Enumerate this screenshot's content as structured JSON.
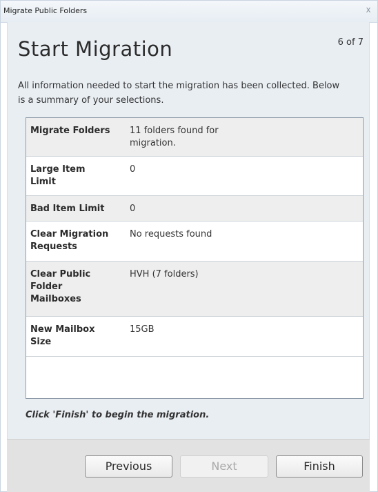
{
  "window": {
    "title": "Migrate Public Folders",
    "close_glyph": "x"
  },
  "header": {
    "title": "Start Migration",
    "step": "6 of 7"
  },
  "intro": "All information needed to start the migration has been collected. Below is a summary of your selections.",
  "summary": {
    "rows": [
      {
        "label": "Migrate Folders",
        "value": "11 folders found for migration."
      },
      {
        "label": "Large Item Limit",
        "value": "0"
      },
      {
        "label": "Bad Item Limit",
        "value": "0"
      },
      {
        "label": "Clear Migration Requests",
        "value": "No requests found"
      },
      {
        "label": "Clear Public Folder Mailboxes",
        "value": "HVH (7 folders)"
      },
      {
        "label": "New Mailbox Size",
        "value": "15GB"
      }
    ]
  },
  "footer": {
    "instruction": "Click 'Finish' to begin the migration."
  },
  "buttons": {
    "previous": "Previous",
    "next": "Next",
    "finish": "Finish"
  },
  "colors": {
    "panel_background": "#e9eef3",
    "shaded_row": "#eeeeee",
    "disabled_text": "#a8a8a8"
  },
  "icons": {
    "close": "close-icon"
  }
}
